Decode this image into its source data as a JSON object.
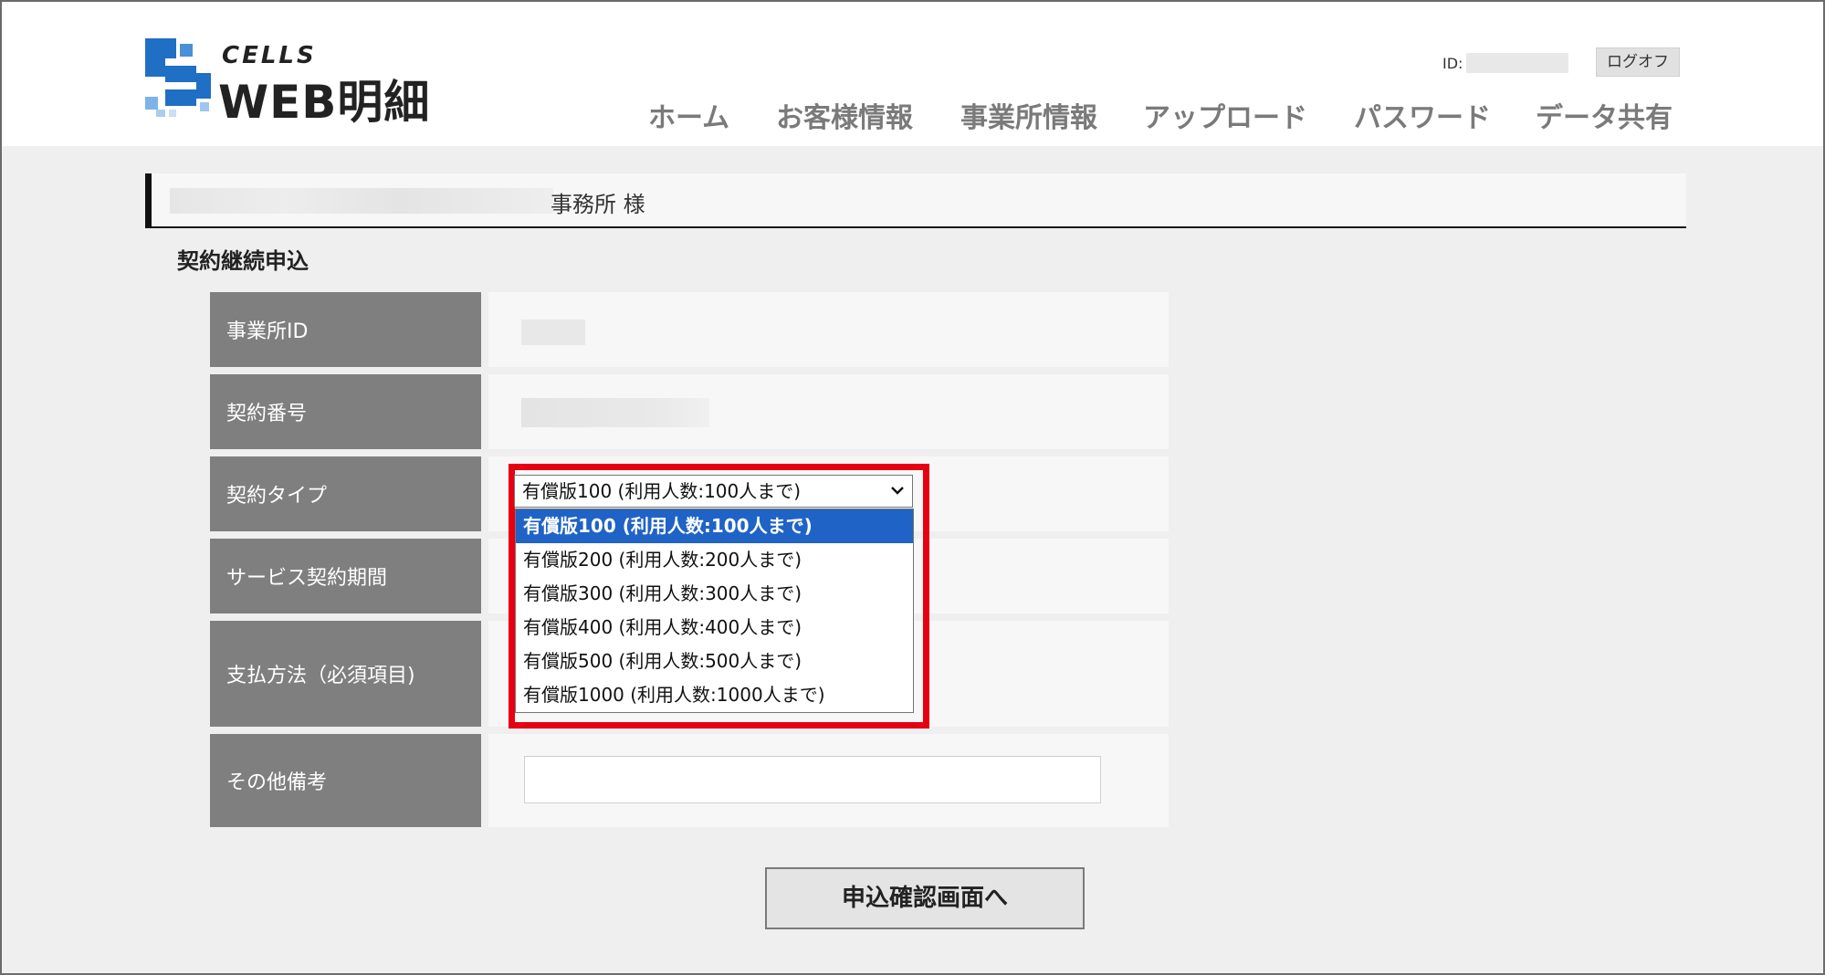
{
  "header": {
    "logo_top": "CELLS",
    "logo_main": "WEB明細",
    "id_label": "ID:",
    "logoff_label": "ログオフ",
    "nav": [
      "ホーム",
      "お客様情報",
      "事業所情報",
      "アップロード",
      "パスワード",
      "データ共有"
    ]
  },
  "office": {
    "suffix": "事務所 様"
  },
  "form": {
    "title": "契約継続申込",
    "rows": {
      "office_id": "事業所ID",
      "contract_number": "契約番号",
      "contract_type": "契約タイプ",
      "service_period": "サービス契約期間",
      "payment_method": "支払方法（必須項目)",
      "other_notes": "その他備考"
    },
    "contract_type_select": {
      "selected": "有償版100 (利用人数:100人まで)",
      "options": [
        "有償版100 (利用人数:100人まで)",
        "有償版200 (利用人数:200人まで)",
        "有償版300 (利用人数:300人まで)",
        "有償版400 (利用人数:400人まで)",
        "有償版500 (利用人数:500人まで)",
        "有償版1000 (利用人数:1000人まで)"
      ]
    },
    "submit_label": "申込確認画面へ"
  },
  "colors": {
    "highlight": "#e60012",
    "selected_option": "#1f63c6",
    "label_bg": "#7f7f7f",
    "logo_blue": "#1f6fc4"
  }
}
